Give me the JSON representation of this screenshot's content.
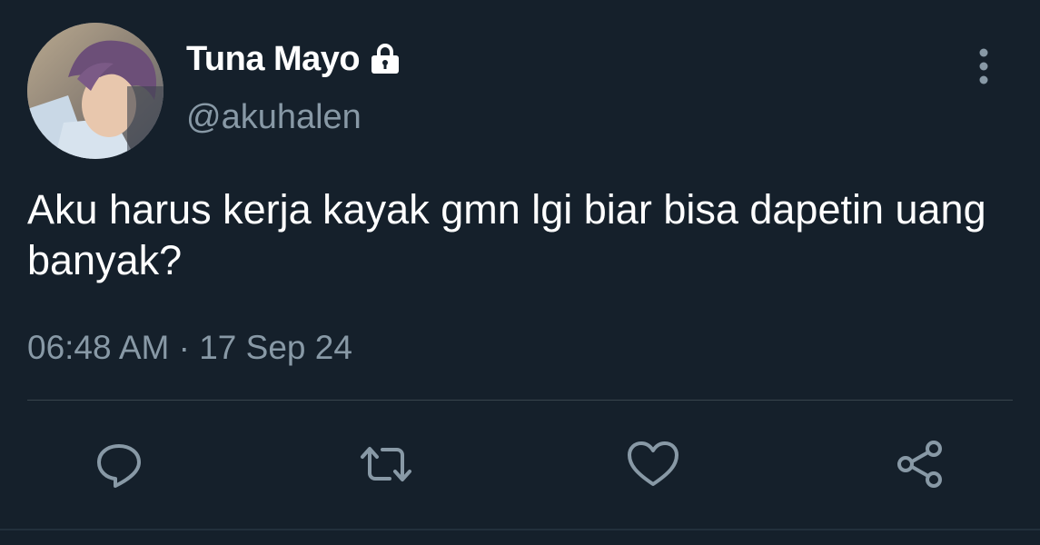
{
  "user": {
    "display_name": "Tuna Mayo",
    "handle": "@akuhalen",
    "protected_icon": "lock-icon",
    "avatar": "profile-photo"
  },
  "tweet": {
    "text": "Aku harus kerja kayak gmn lgi biar bisa dapetin uang banyak?",
    "timestamp": "06:48 AM · 17 Sep 24"
  },
  "actions": [
    {
      "icon": "reply-icon"
    },
    {
      "icon": "retweet-icon"
    },
    {
      "icon": "like-icon"
    },
    {
      "icon": "share-icon"
    }
  ],
  "menu": {
    "icon": "more-vertical-icon"
  },
  "colors": {
    "background": "#15202b",
    "primary_text": "#ffffff",
    "secondary_text": "#8899a6",
    "divider": "#38444d"
  }
}
